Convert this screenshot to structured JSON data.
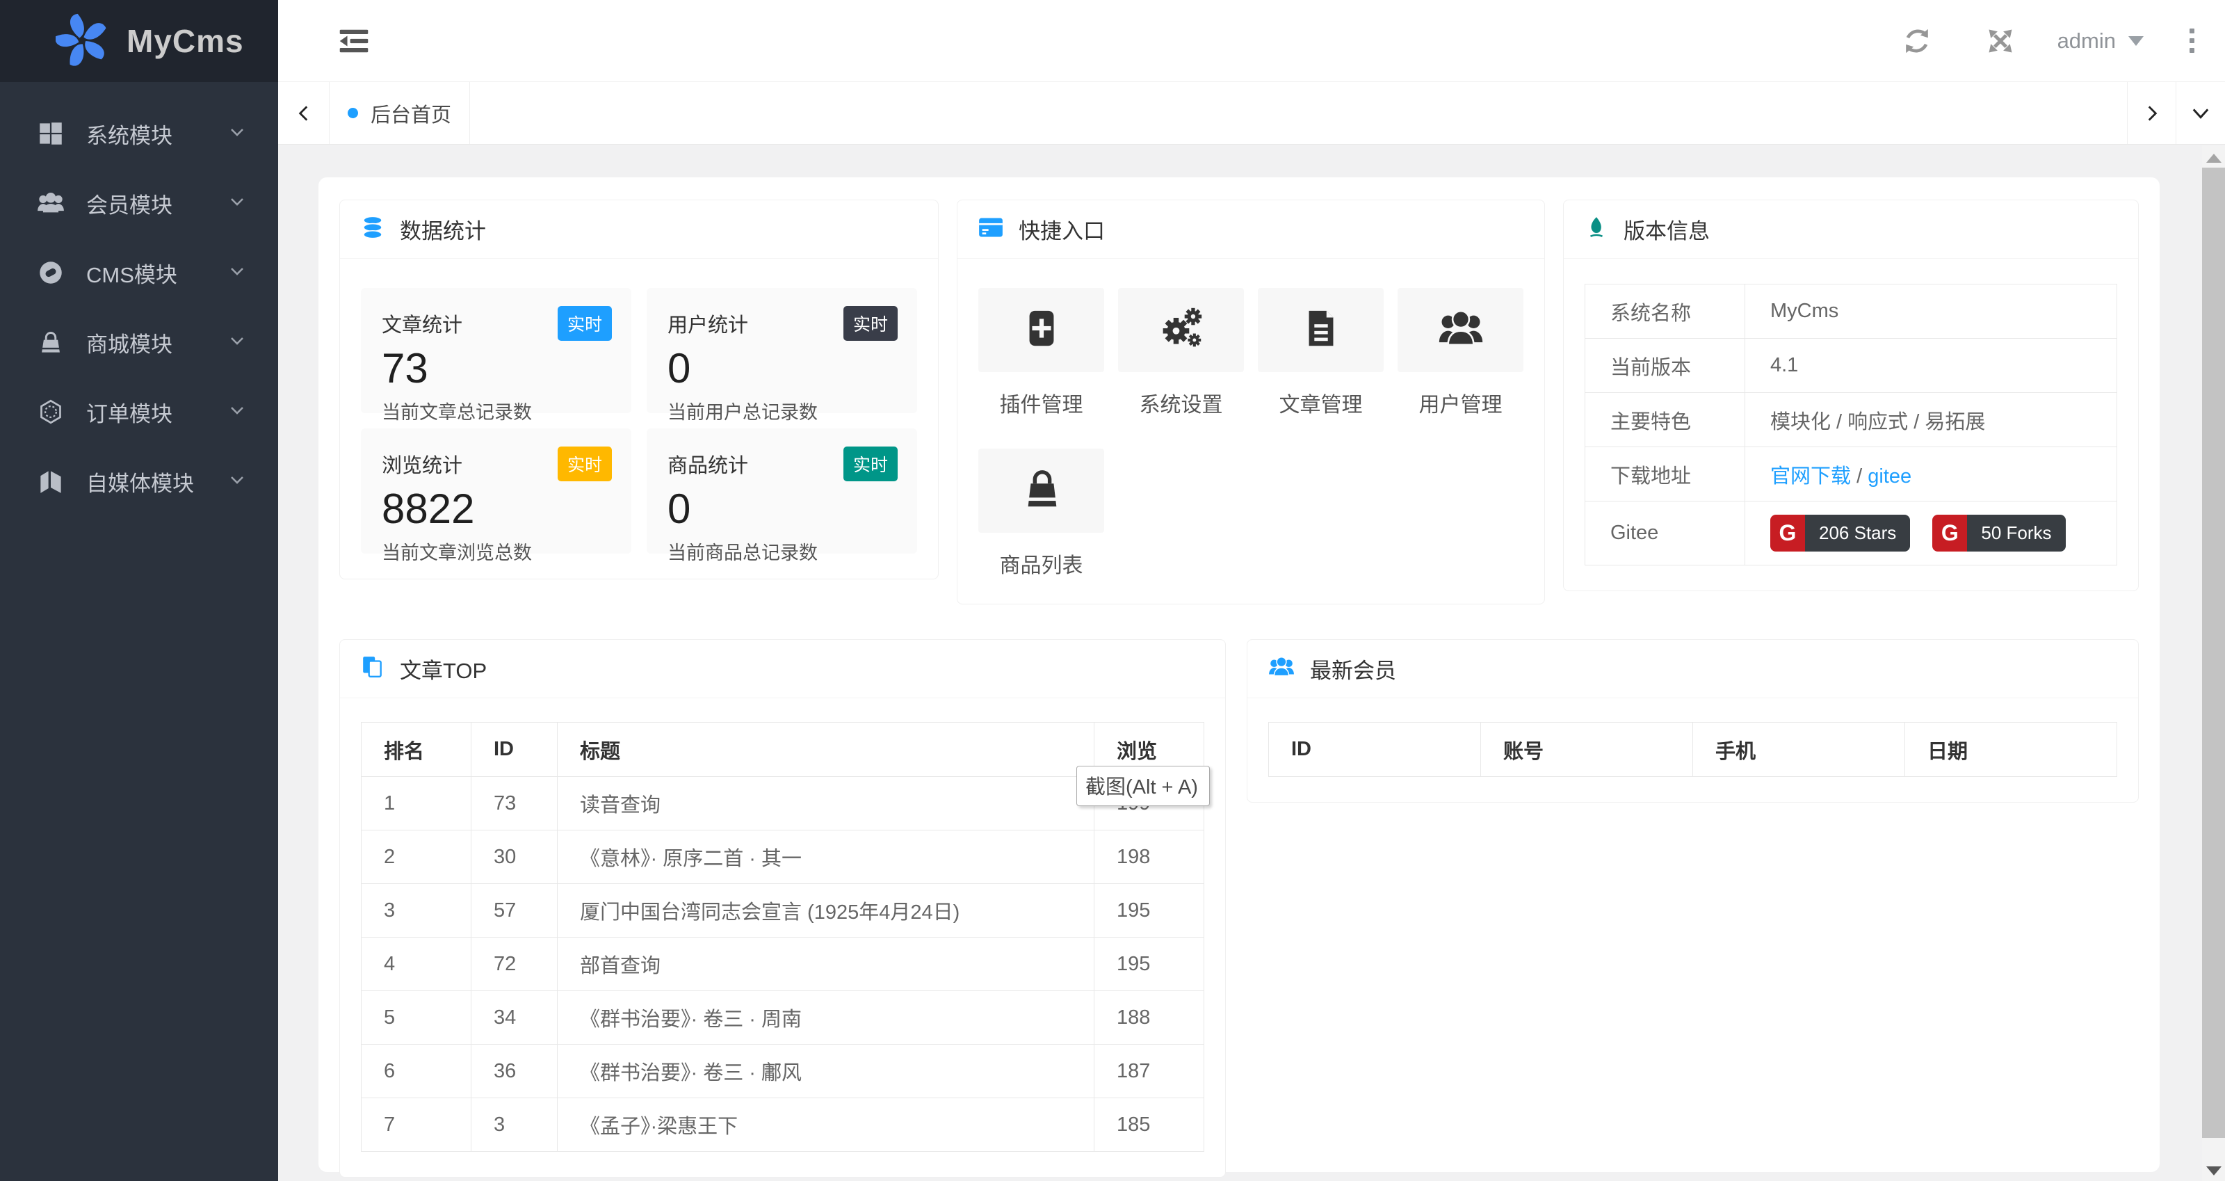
{
  "app": {
    "title": "MyCms"
  },
  "topbar": {
    "user_label": "admin"
  },
  "tabs": {
    "active_label": "后台首页"
  },
  "sidebar": {
    "items": [
      {
        "label": "系统模块",
        "icon": "windows-grid-icon"
      },
      {
        "label": "会员模块",
        "icon": "users-icon"
      },
      {
        "label": "CMS模块",
        "icon": "circle-gem-icon"
      },
      {
        "label": "商城模块",
        "icon": "shopping-bag-icon"
      },
      {
        "label": "订单模块",
        "icon": "hexagon-icon"
      },
      {
        "label": "自媒体模块",
        "icon": "medium-icon"
      }
    ]
  },
  "colors": {
    "accent": "#1E9FFF",
    "sidebar_bg": "#2B323D",
    "logo_bg": "#20252E",
    "teal": "#009688",
    "yellow": "#FFB800",
    "navy": "#393D49",
    "gitee_red": "#C71D23"
  },
  "stats": {
    "title": "数据统计",
    "boxes": [
      {
        "title": "文章统计",
        "badge": "实时",
        "badge_color": "#1E9FFF",
        "value": "73",
        "caption": "当前文章总记录数"
      },
      {
        "title": "用户统计",
        "badge": "实时",
        "badge_color": "#393D49",
        "value": "0",
        "caption": "当前用户总记录数"
      },
      {
        "title": "浏览统计",
        "badge": "实时",
        "badge_color": "#FFB800",
        "value": "8822",
        "caption": "当前文章浏览总数"
      },
      {
        "title": "商品统计",
        "badge": "实时",
        "badge_color": "#009688",
        "value": "0",
        "caption": "当前商品总记录数"
      }
    ]
  },
  "quick": {
    "title": "快捷入口",
    "items": [
      {
        "label": "插件管理",
        "icon": "plugin-plus-icon"
      },
      {
        "label": "系统设置",
        "icon": "gears-icon"
      },
      {
        "label": "文章管理",
        "icon": "document-icon"
      },
      {
        "label": "用户管理",
        "icon": "users-icon"
      },
      {
        "label": "商品列表",
        "icon": "shopping-bag-icon"
      }
    ]
  },
  "version": {
    "title": "版本信息",
    "rows": [
      {
        "label": "系统名称",
        "value": "MyCms"
      },
      {
        "label": "当前版本",
        "value": "4.1"
      },
      {
        "label": "主要特色",
        "value": "模块化 / 响应式 / 易拓展"
      },
      {
        "label": "下载地址",
        "link1": "官网下载",
        "sep": " / ",
        "link2": "gitee"
      },
      {
        "label": "Gitee"
      }
    ],
    "badges": [
      {
        "logo": "G",
        "text": "206 Stars"
      },
      {
        "logo": "G",
        "text": "50 Forks"
      }
    ]
  },
  "articles": {
    "title": "文章TOP",
    "headers": [
      "排名",
      "ID",
      "标题",
      "浏览"
    ],
    "rows": [
      [
        "1",
        "73",
        "读音查询",
        "199"
      ],
      [
        "2",
        "30",
        "《意林》· 原序二首 · 其一",
        "198"
      ],
      [
        "3",
        "57",
        "厦门中国台湾同志会宣言 (1925年4月24日)",
        "195"
      ],
      [
        "4",
        "72",
        "部首查询",
        "195"
      ],
      [
        "5",
        "34",
        "《群书治要》· 卷三 · 周南",
        "188"
      ],
      [
        "6",
        "36",
        "《群书治要》· 卷三 · 鄘风",
        "187"
      ],
      [
        "7",
        "3",
        "《孟子》·梁惠王下",
        "185"
      ]
    ]
  },
  "members": {
    "title": "最新会员",
    "headers": [
      "ID",
      "账号",
      "手机",
      "日期"
    ]
  },
  "tooltip": {
    "text": "截图(Alt + A)"
  }
}
